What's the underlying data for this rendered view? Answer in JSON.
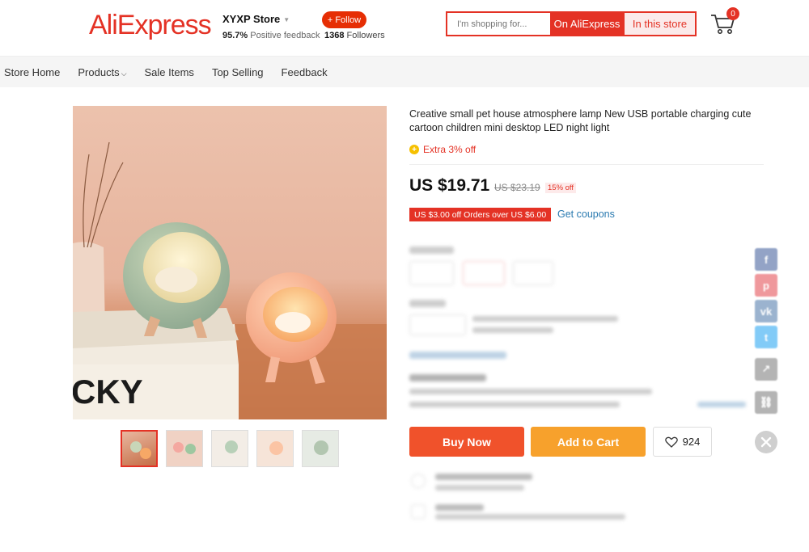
{
  "header": {
    "logo": "AliExpress",
    "store_name": "XYXP Store",
    "rating_value": "95.7%",
    "rating_label": "Positive feedback",
    "follow_label": "+ Follow",
    "followers_count": "1368",
    "followers_label": "Followers",
    "search_placeholder": "I'm shopping for...",
    "search_ali_label": "On AliExpress",
    "search_store_label": "In this store",
    "cart_count": "0"
  },
  "nav": {
    "items": [
      "Store Home",
      "Products",
      "Sale Items",
      "Top Selling",
      "Feedback"
    ]
  },
  "product": {
    "title": "Creative small pet house atmosphere lamp New USB portable charging cute cartoon children mini desktop LED night light",
    "extra_off": "Extra 3% off",
    "price": "US $19.71",
    "original_price": "US $23.19",
    "discount": "15% off",
    "coupon": "US $3.00 off Orders over US $6.00",
    "get_coupons": "Get coupons",
    "image_book_text": "CKY",
    "thumbnails": 5
  },
  "actions": {
    "buy_now": "Buy Now",
    "add_to_cart": "Add to Cart",
    "wishlist_count": "924"
  },
  "colors": {
    "brand_red": "#e43225",
    "buy_now": "#f0522b",
    "add_to_cart": "#f7a12c",
    "link_blue": "#2a7ab0"
  },
  "social_icons": [
    "facebook-icon",
    "pinterest-icon",
    "vk-icon",
    "twitter-icon",
    "share-icon",
    "link-icon"
  ]
}
